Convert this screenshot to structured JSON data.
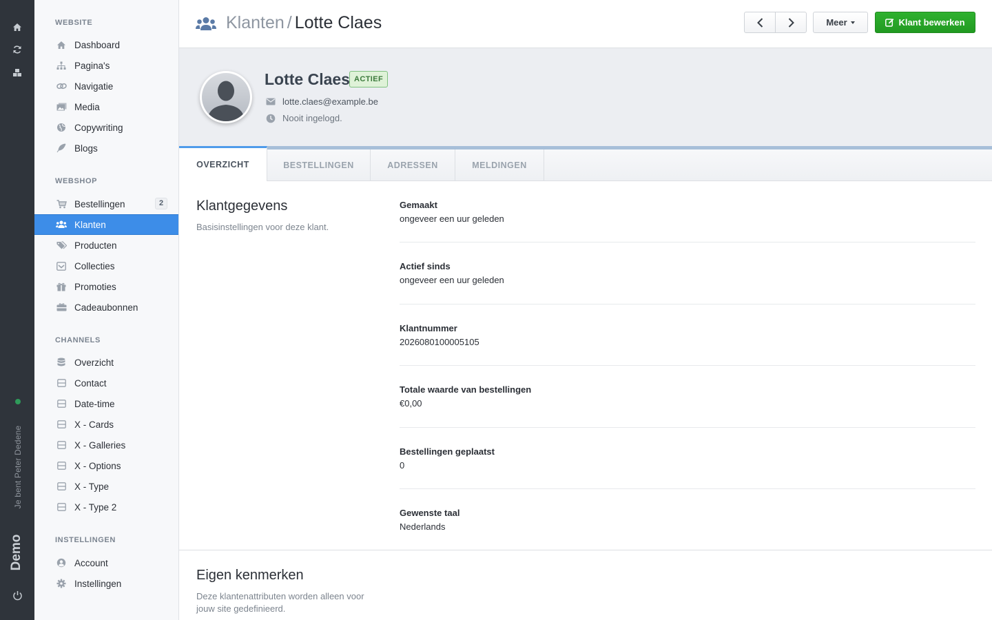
{
  "rail": {
    "user_label": "Je bent Peter Dedene",
    "brand": "Demo",
    "icons": [
      "home-icon",
      "refresh-icon",
      "cubes-icon",
      "power-icon"
    ]
  },
  "sidebar": {
    "sections": [
      {
        "title": "WEBSITE",
        "items": [
          {
            "label": "Dashboard",
            "icon": "home-icon"
          },
          {
            "label": "Pagina's",
            "icon": "sitemap-icon"
          },
          {
            "label": "Navigatie",
            "icon": "link-icon"
          },
          {
            "label": "Media",
            "icon": "images-icon"
          },
          {
            "label": "Copywriting",
            "icon": "globe-icon"
          },
          {
            "label": "Blogs",
            "icon": "feather-icon"
          }
        ]
      },
      {
        "title": "WEBSHOP",
        "items": [
          {
            "label": "Bestellingen",
            "icon": "cart-icon",
            "badge": "2"
          },
          {
            "label": "Klanten",
            "icon": "users-icon",
            "active": true
          },
          {
            "label": "Producten",
            "icon": "tags-icon"
          },
          {
            "label": "Collecties",
            "icon": "inbox-icon"
          },
          {
            "label": "Promoties",
            "icon": "gift-icon"
          },
          {
            "label": "Cadeaubonnen",
            "icon": "gift-card-icon"
          }
        ]
      },
      {
        "title": "CHANNELS",
        "items": [
          {
            "label": "Overzicht",
            "icon": "database-icon"
          },
          {
            "label": "Contact",
            "icon": "channel-icon"
          },
          {
            "label": "Date-time",
            "icon": "channel-icon"
          },
          {
            "label": "X - Cards",
            "icon": "channel-icon"
          },
          {
            "label": "X - Galleries",
            "icon": "channel-icon"
          },
          {
            "label": "X - Options",
            "icon": "channel-icon"
          },
          {
            "label": "X - Type",
            "icon": "channel-icon"
          },
          {
            "label": "X - Type 2",
            "icon": "channel-icon"
          }
        ]
      },
      {
        "title": "INSTELLINGEN",
        "items": [
          {
            "label": "Account",
            "icon": "user-circle-icon"
          },
          {
            "label": "Instellingen",
            "icon": "gear-icon"
          }
        ]
      }
    ]
  },
  "header": {
    "breadcrumb_parent": "Klanten",
    "breadcrumb_sep": "/",
    "breadcrumb_current": "Lotte Claes",
    "more_label": "Meer",
    "edit_label": "Klant bewerken"
  },
  "profile": {
    "name": "Lotte Claes",
    "status": "ACTIEF",
    "email": "lotte.claes@example.be",
    "last_login": "Nooit ingelogd."
  },
  "tabs": [
    {
      "label": "OVERZICHT",
      "active": true
    },
    {
      "label": "BESTELLINGEN"
    },
    {
      "label": "ADRESSEN"
    },
    {
      "label": "MELDINGEN"
    }
  ],
  "customer_section": {
    "title": "Klantgegevens",
    "description": "Basisinstellingen voor deze klant.",
    "fields": [
      {
        "key": "Gemaakt",
        "value": "ongeveer een uur geleden"
      },
      {
        "key": "Actief sinds",
        "value": "ongeveer een uur geleden"
      },
      {
        "key": "Klantnummer",
        "value": "2026080100005105"
      },
      {
        "key": "Totale waarde van bestellingen",
        "value": "€0,00"
      },
      {
        "key": "Bestellingen geplaatst",
        "value": "0"
      },
      {
        "key": "Gewenste taal",
        "value": "Nederlands"
      }
    ]
  },
  "attributes_section": {
    "title": "Eigen kenmerken",
    "description": "Deze klantenattributen worden alleen voor jouw site gedefinieerd."
  },
  "colors": {
    "accent": "#3d8de8",
    "success": "#2fb12f",
    "rail": "#2f343b"
  }
}
